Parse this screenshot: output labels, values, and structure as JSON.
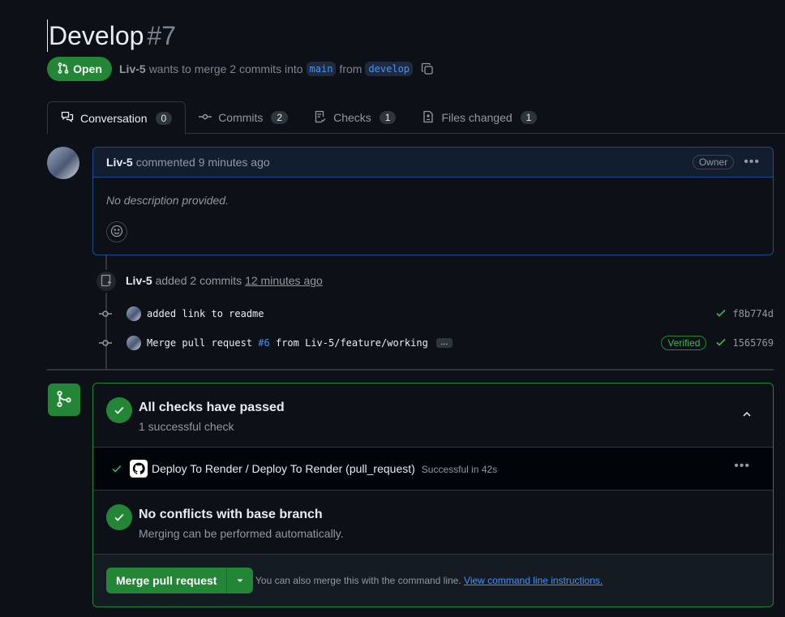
{
  "pr": {
    "title": "Develop",
    "number": "#7",
    "state": "Open",
    "author": "Liv-5",
    "merge_text": "wants to merge 2 commits into",
    "base_branch": "main",
    "from_text": "from",
    "head_branch": "develop"
  },
  "tabs": [
    {
      "label": "Conversation",
      "count": "0"
    },
    {
      "label": "Commits",
      "count": "2"
    },
    {
      "label": "Checks",
      "count": "1"
    },
    {
      "label": "Files changed",
      "count": "1"
    }
  ],
  "comment": {
    "author": "Liv-5",
    "action": "commented 9 minutes ago",
    "role": "Owner",
    "body": "No description provided."
  },
  "timeline": {
    "author": "Liv-5",
    "action": "added 2 commits",
    "time": "12 minutes ago",
    "commits": [
      {
        "message": "added link to readme",
        "sha": "f8b774d"
      },
      {
        "message_prefix": "Merge pull request",
        "link": "#6",
        "message_suffix": "from Liv-5/feature/working",
        "more": "…",
        "badge": "Verified",
        "sha": "1565769"
      }
    ]
  },
  "merge": {
    "checks_title": "All checks have passed",
    "checks_sub": "1 successful check",
    "check_run": {
      "name": "Deploy To Render / Deploy To Render (pull_request)",
      "status": "Successful in 42s"
    },
    "conflicts_title": "No conflicts with base branch",
    "conflicts_sub": "Merging can be performed automatically.",
    "button_label": "Merge pull request",
    "hint": "You can also merge this with the command line.",
    "hint_link": "View command line instructions."
  },
  "colors": {
    "accent_green": "#238636",
    "link_blue": "#4493f8",
    "bg": "#0d1117"
  }
}
